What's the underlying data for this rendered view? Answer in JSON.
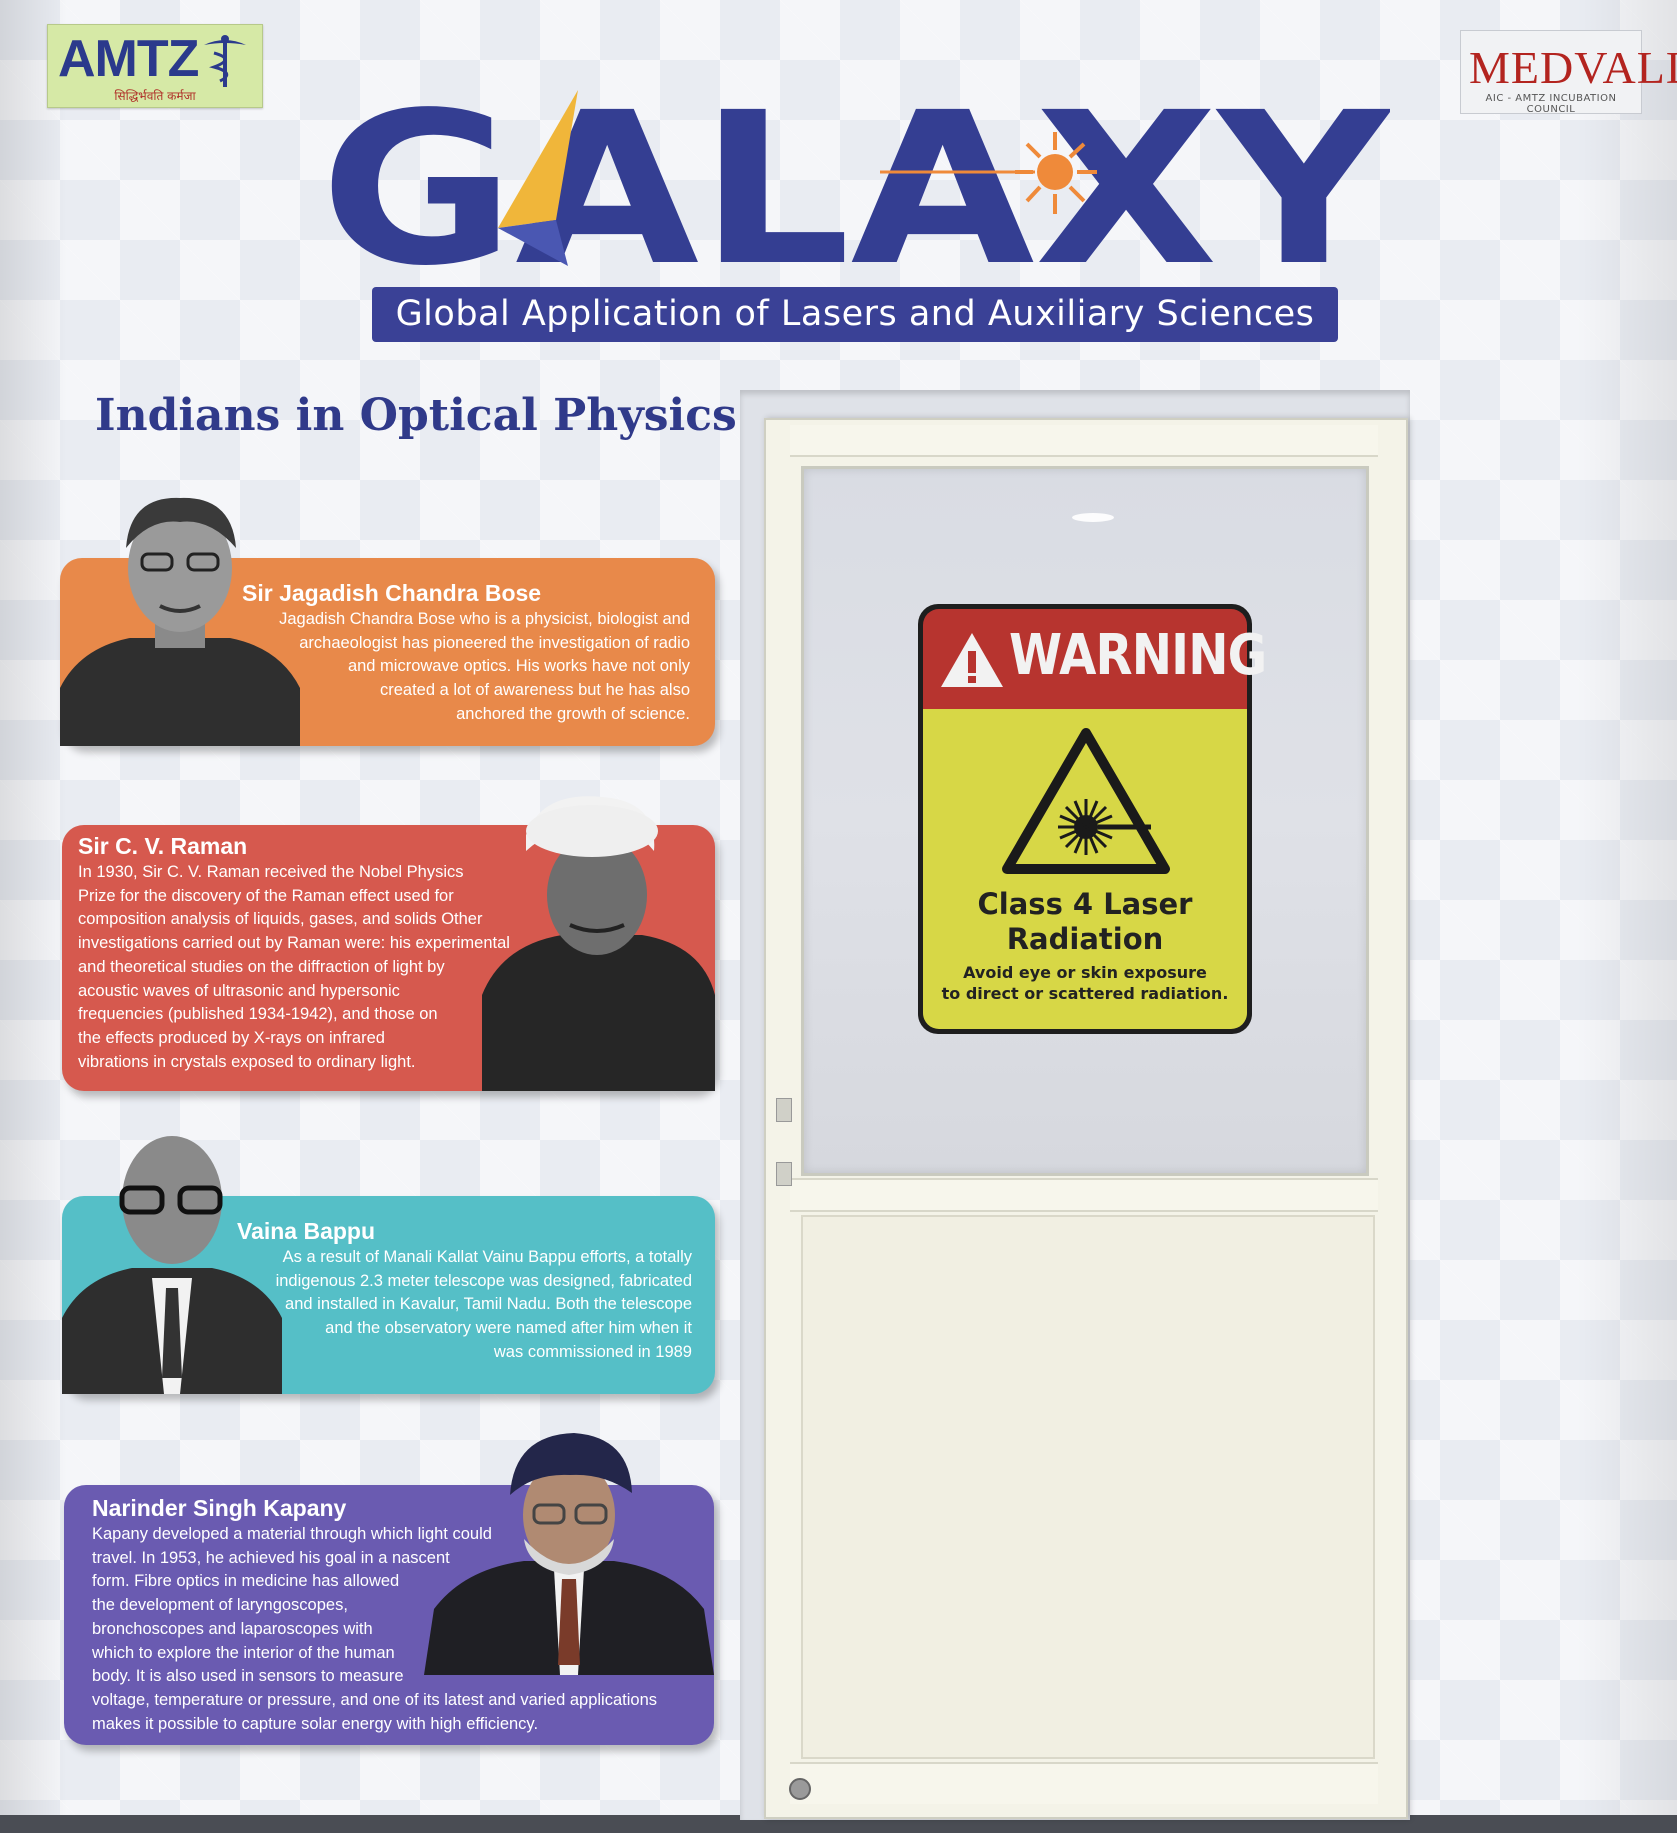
{
  "logos": {
    "amtz": {
      "name": "AMTZ",
      "tagline": "सिद्धिर्भवति कर्मजा"
    },
    "medvalley": {
      "name": "MEDVALLEY",
      "sub": "AIC - AMTZ INCUBATION COUNCIL"
    }
  },
  "header": {
    "title": "GALAXY",
    "subtitle": "Global  Application of Lasers and Auxiliary Sciences"
  },
  "section": {
    "title": "Indians in Optical Physics"
  },
  "panels": [
    {
      "name": "Sir Jagadish Chandra Bose",
      "lines": [
        "Jagadish Chandra Bose who is a physicist, biologist and",
        "archaeologist has pioneered the investigation of radio",
        "and microwave optics. His works have not only",
        "created a lot of awareness but he has also",
        "anchored the growth of science."
      ]
    },
    {
      "name": "Sir C. V. Raman",
      "lines": [
        "In 1930, Sir C. V. Raman received the Nobel Physics",
        "Prize for the discovery of the Raman effect used for",
        "composition analysis of liquids, gases, and solids Other",
        "investigations carried out by Raman were: his experimental",
        "and theoretical studies on the diffraction of light by",
        "acoustic waves of ultrasonic and hypersonic",
        "frequencies (published 1934-1942), and those on",
        "the effects produced by X-rays on infrared",
        "vibrations in crystals exposed to ordinary light."
      ]
    },
    {
      "name": "Vaina Bappu",
      "lines": [
        "As a result of Manali Kallat Vainu Bappu  efforts, a totally",
        "indigenous 2.3 meter telescope was designed, fabricated",
        "and installed in Kavalur, Tamil Nadu. Both the telescope",
        "and the observatory were named after him when it",
        "was commissioned in 1989"
      ]
    },
    {
      "name": "Narinder Singh Kapany",
      "lines": [
        "Kapany developed a material through which light could",
        "travel. In 1953, he achieved his goal in a nascent",
        "form. Fibre optics in medicine has allowed",
        "the development of laryngoscopes,",
        "bronchoscopes and laparoscopes with",
        "which to explore the interior of the human",
        "body. It is also used in sensors to measure",
        "voltage, temperature or pressure, and one of its latest and varied applications",
        "makes it possible to capture solar energy with high efficiency."
      ]
    }
  ],
  "sign": {
    "word": "WARNING",
    "class_line1": "Class 4 Laser",
    "class_line2": "Radiation",
    "note_line1": "Avoid eye or skin exposure",
    "note_line2": "to direct or scattered radiation."
  }
}
